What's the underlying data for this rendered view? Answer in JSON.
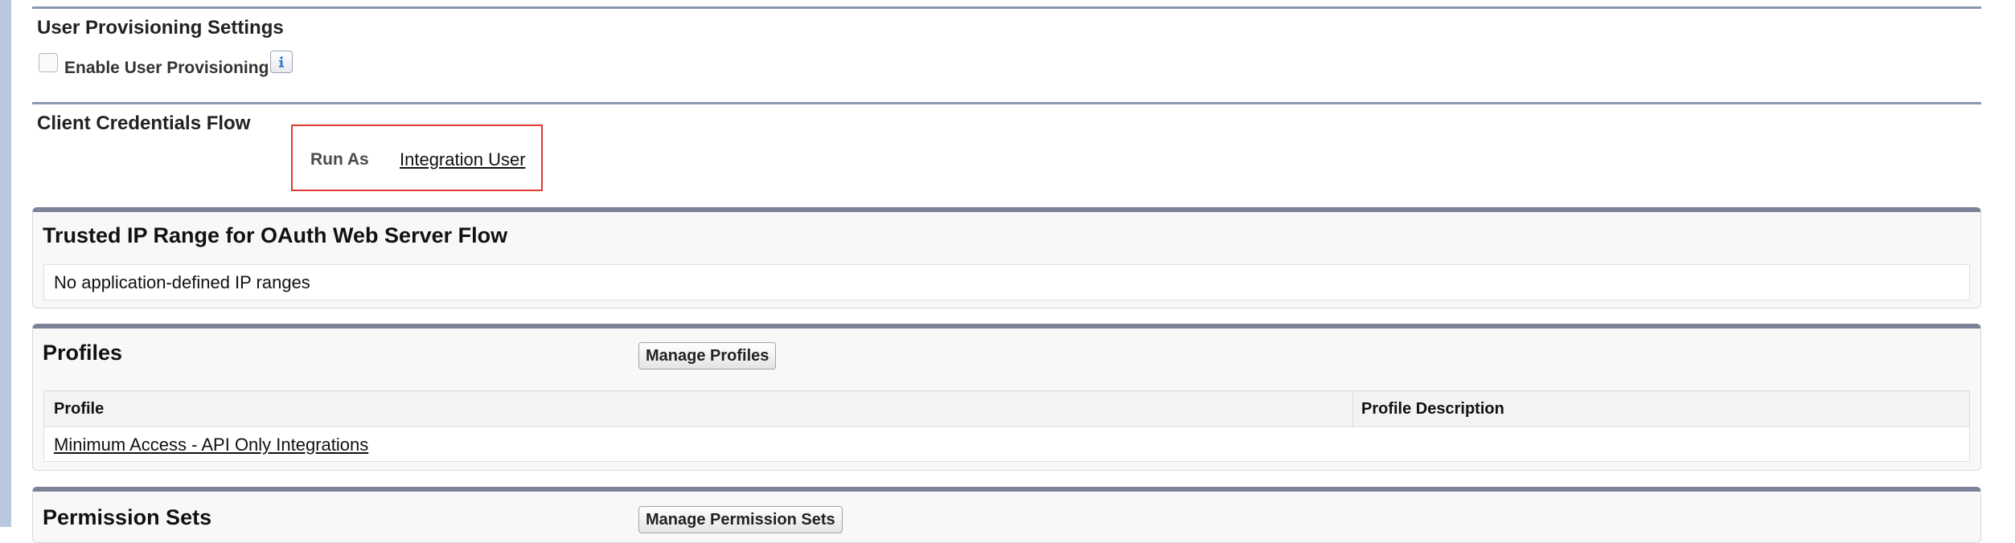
{
  "user_provisioning": {
    "title": "User Provisioning Settings",
    "enable_label": "Enable User Provisioning",
    "enabled": false
  },
  "client_credentials": {
    "title": "Client Credentials Flow",
    "run_as_label": "Run As",
    "run_as_value": "Integration User"
  },
  "trusted_ip": {
    "title": "Trusted IP Range for OAuth Web Server Flow",
    "empty_message": "No application-defined IP ranges"
  },
  "profiles": {
    "title": "Profiles",
    "manage_button": "Manage Profiles",
    "columns": [
      "Profile",
      "Profile Description"
    ],
    "rows": [
      {
        "profile": "Minimum Access - API Only Integrations",
        "description": ""
      }
    ]
  },
  "permission_sets": {
    "title": "Permission Sets",
    "manage_button": "Manage Permission Sets"
  },
  "colors": {
    "highlight_border": "#e03a2f",
    "section_rule": "#8a97b1",
    "panel_top": "#7c8298",
    "rail": "#b9c7df"
  }
}
